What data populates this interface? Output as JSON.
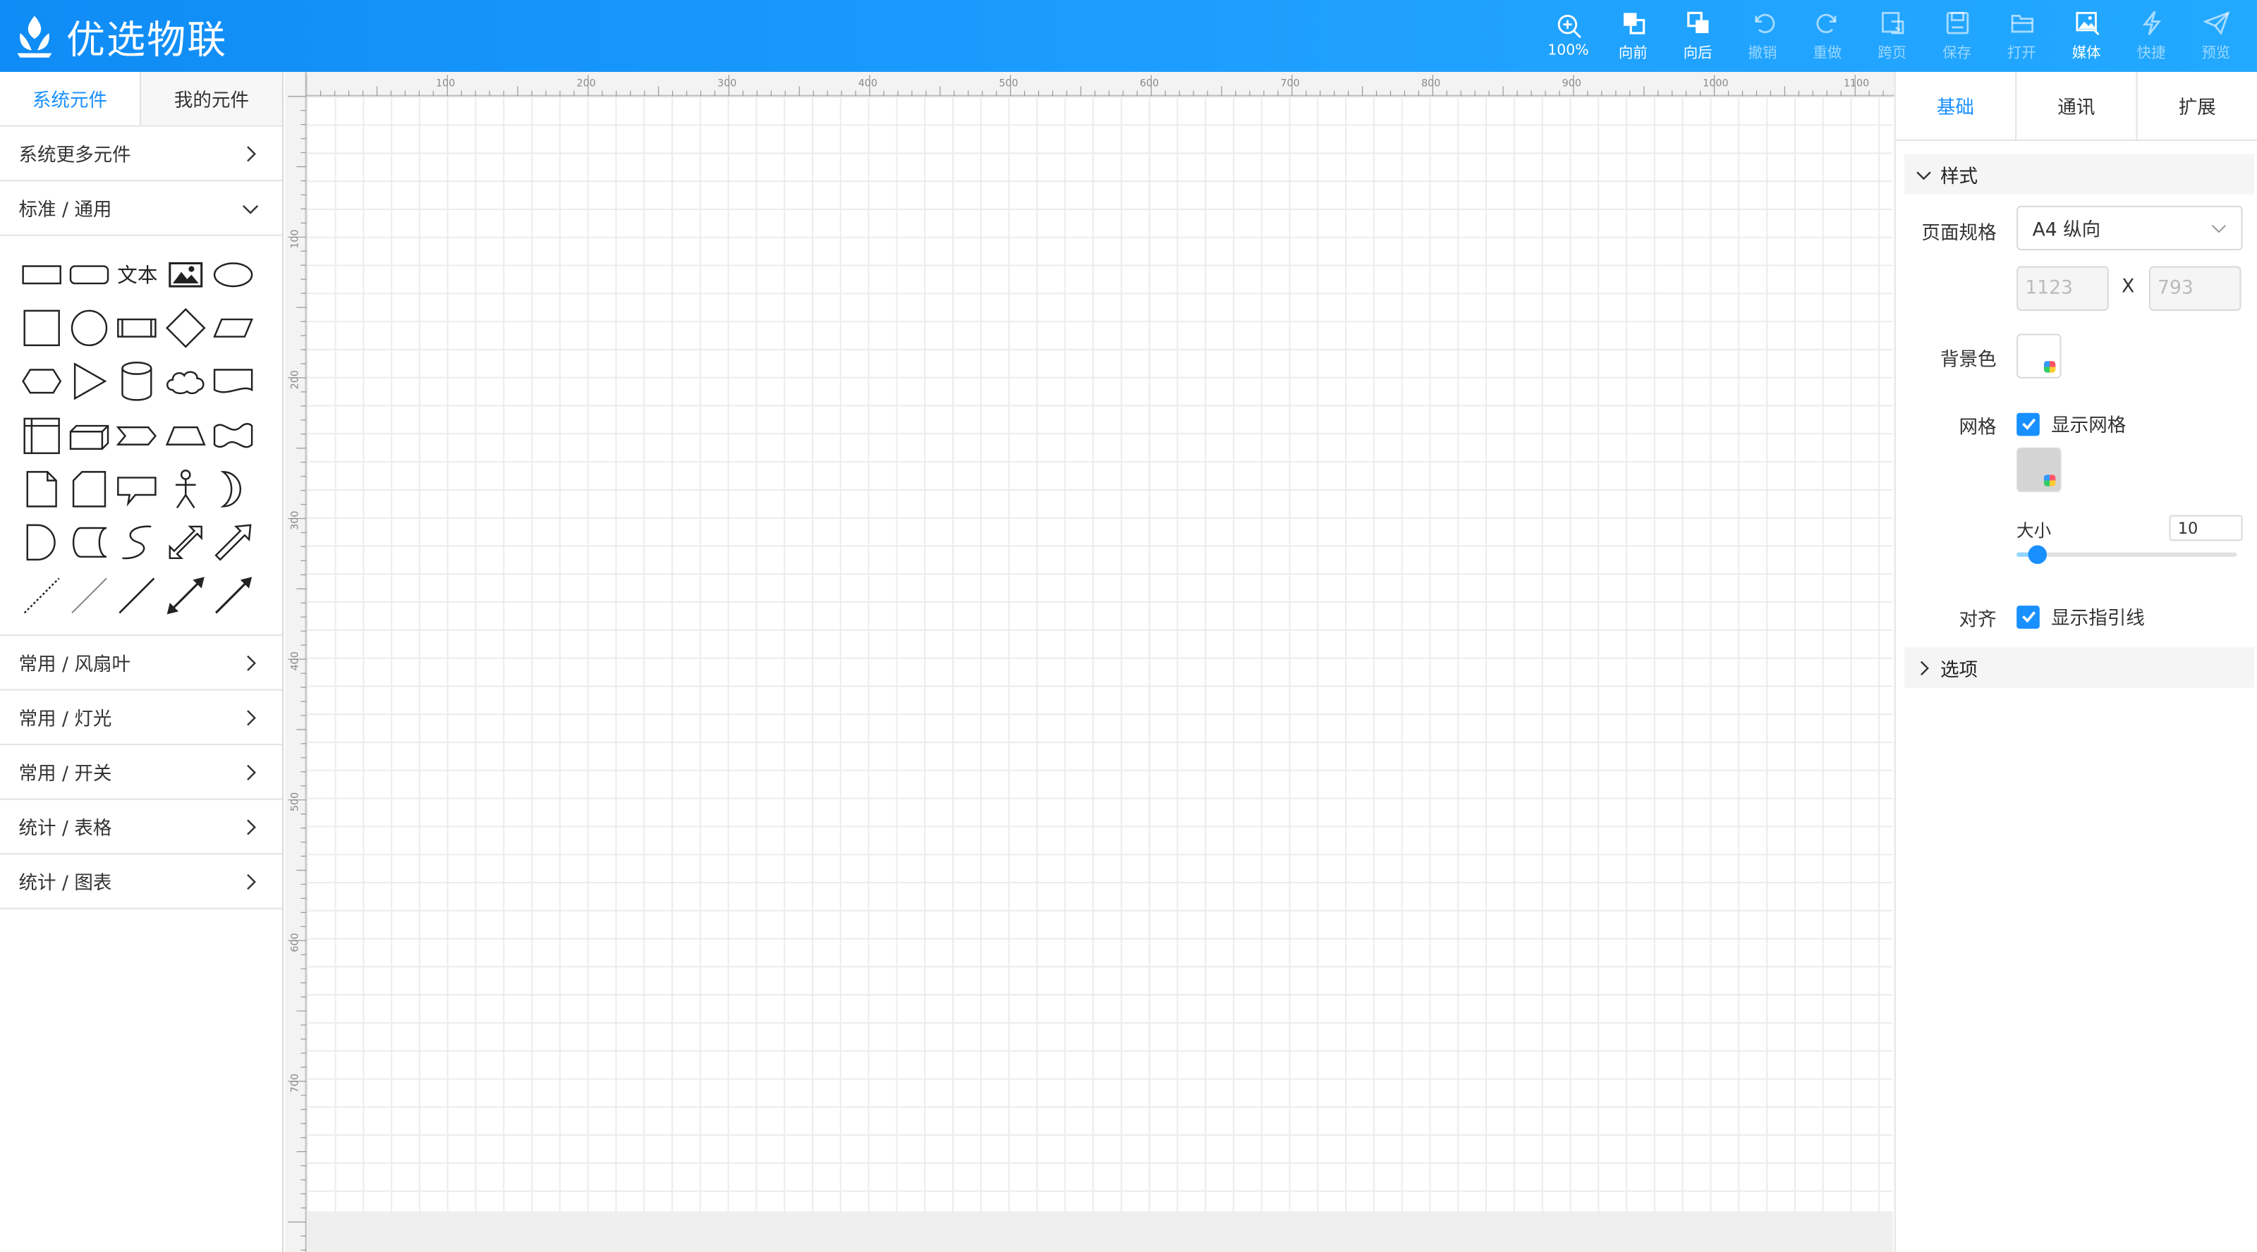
{
  "app": {
    "title": "优选物联"
  },
  "toolbar": [
    {
      "icon": "zoom-icon",
      "label": "100%",
      "enabled": true
    },
    {
      "icon": "bring-forward-icon",
      "label": "向前",
      "enabled": true
    },
    {
      "icon": "send-backward-icon",
      "label": "向后",
      "enabled": true
    },
    {
      "icon": "undo-icon",
      "label": "撤销",
      "enabled": false
    },
    {
      "icon": "redo-icon",
      "label": "重做",
      "enabled": false
    },
    {
      "icon": "cross-page-icon",
      "label": "跨页",
      "enabled": false
    },
    {
      "icon": "save-icon",
      "label": "保存",
      "enabled": false
    },
    {
      "icon": "open-folder-icon",
      "label": "打开",
      "enabled": false
    },
    {
      "icon": "media-icon",
      "label": "媒体",
      "enabled": true
    },
    {
      "icon": "lightning-icon",
      "label": "快捷",
      "enabled": false
    },
    {
      "icon": "preview-send-icon",
      "label": "预览",
      "enabled": false
    }
  ],
  "left_panel": {
    "tabs": [
      "系统元件",
      "我的元件"
    ],
    "active_tab": 0,
    "categories_top": [
      {
        "label": "系统更多元件",
        "expanded": false
      },
      {
        "label": "标准 / 通用",
        "expanded": true
      }
    ],
    "shape_text_label": "文本",
    "categories_bottom": [
      {
        "label": "常用 / 风扇叶"
      },
      {
        "label": "常用 / 灯光"
      },
      {
        "label": "常用 / 开关"
      },
      {
        "label": "统计 / 表格"
      },
      {
        "label": "统计 / 图表"
      }
    ]
  },
  "ruler": {
    "top_labels": [
      "100",
      "200",
      "300",
      "400",
      "500",
      "600",
      "700",
      "800",
      "900",
      "1000",
      "1100"
    ],
    "left_labels": [
      "100",
      "200",
      "300",
      "400",
      "500",
      "600",
      "700"
    ]
  },
  "right_panel": {
    "tabs": [
      "基础",
      "通讯",
      "扩展"
    ],
    "active_tab": 0,
    "style_section": "样式",
    "page_size_label": "页面规格",
    "page_size_value": "A4 纵向",
    "width_value": "1123",
    "height_value": "793",
    "x_sep": "X",
    "bg_color_label": "背景色",
    "grid_label": "网格",
    "show_grid_label": "显示网格",
    "show_grid_checked": true,
    "size_label": "大小",
    "grid_size_value": "10",
    "grid_size_slider": 10,
    "align_label": "对齐",
    "show_guides_label": "显示指引线",
    "show_guides_checked": true,
    "options_section": "选项"
  },
  "colors": {
    "header": "#1a9aff",
    "accent": "#1890ff",
    "grid": "#ececec"
  }
}
